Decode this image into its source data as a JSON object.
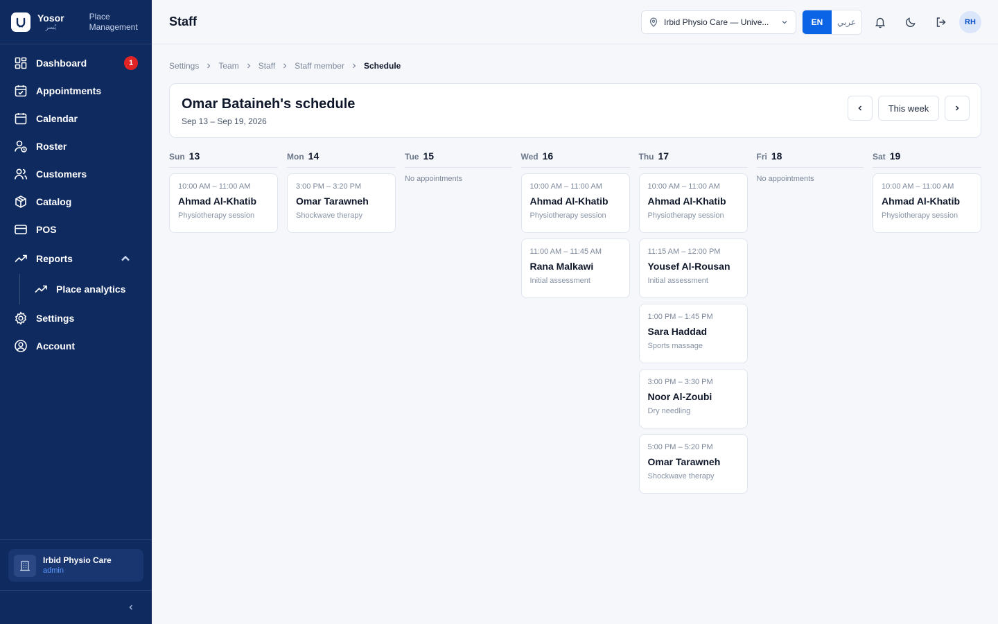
{
  "brand": {
    "name": "Yosor",
    "name_ar": "يُسر",
    "subtitle_line1": "Place",
    "subtitle_line2": "Management"
  },
  "sidebar": {
    "items": [
      {
        "label": "Dashboard",
        "badge": "1"
      },
      {
        "label": "Appointments"
      },
      {
        "label": "Calendar"
      },
      {
        "label": "Roster"
      },
      {
        "label": "Customers"
      },
      {
        "label": "Catalog"
      },
      {
        "label": "POS"
      },
      {
        "label": "Reports"
      },
      {
        "label": "Place analytics"
      },
      {
        "label": "Settings"
      },
      {
        "label": "Account"
      }
    ],
    "place": {
      "name": "Irbid Physio Care",
      "role": "admin"
    }
  },
  "topbar": {
    "title": "Staff",
    "place_select": "Irbid Physio Care — Unive...",
    "lang_en": "EN",
    "lang_ar": "عربي",
    "avatar": "RH"
  },
  "breadcrumb": [
    "Settings",
    "Team",
    "Staff",
    "Staff member",
    "Schedule"
  ],
  "schedule": {
    "title": "Omar Bataineh's schedule",
    "range": "Sep 13 – Sep 19, 2026",
    "this_week": "This week",
    "days": [
      {
        "dow": "Sun",
        "num": "13",
        "appointments": [
          {
            "time": "10:00 AM – 11:00 AM",
            "customer": "Ahmad Al-Khatib",
            "service": "Physiotherapy session"
          }
        ]
      },
      {
        "dow": "Mon",
        "num": "14",
        "appointments": [
          {
            "time": "3:00 PM – 3:20 PM",
            "customer": "Omar Tarawneh",
            "service": "Shockwave therapy"
          }
        ]
      },
      {
        "dow": "Tue",
        "num": "15",
        "empty": "No appointments",
        "appointments": []
      },
      {
        "dow": "Wed",
        "num": "16",
        "appointments": [
          {
            "time": "10:00 AM – 11:00 AM",
            "customer": "Ahmad Al-Khatib",
            "service": "Physiotherapy session"
          },
          {
            "time": "11:00 AM – 11:45 AM",
            "customer": "Rana Malkawi",
            "service": "Initial assessment"
          }
        ]
      },
      {
        "dow": "Thu",
        "num": "17",
        "appointments": [
          {
            "time": "10:00 AM – 11:00 AM",
            "customer": "Ahmad Al-Khatib",
            "service": "Physiotherapy session"
          },
          {
            "time": "11:15 AM – 12:00 PM",
            "customer": "Yousef Al-Rousan",
            "service": "Initial assessment"
          },
          {
            "time": "1:00 PM – 1:45 PM",
            "customer": "Sara Haddad",
            "service": "Sports massage"
          },
          {
            "time": "3:00 PM – 3:30 PM",
            "customer": "Noor Al-Zoubi",
            "service": "Dry needling"
          },
          {
            "time": "5:00 PM – 5:20 PM",
            "customer": "Omar Tarawneh",
            "service": "Shockwave therapy"
          }
        ]
      },
      {
        "dow": "Fri",
        "num": "18",
        "empty": "No appointments",
        "appointments": []
      },
      {
        "dow": "Sat",
        "num": "19",
        "appointments": [
          {
            "time": "10:00 AM – 11:00 AM",
            "customer": "Ahmad Al-Khatib",
            "service": "Physiotherapy session"
          }
        ]
      }
    ]
  },
  "colors": {
    "sidebar": "#0f2a5f",
    "accent": "#0b63e5",
    "badge": "#e02424"
  }
}
